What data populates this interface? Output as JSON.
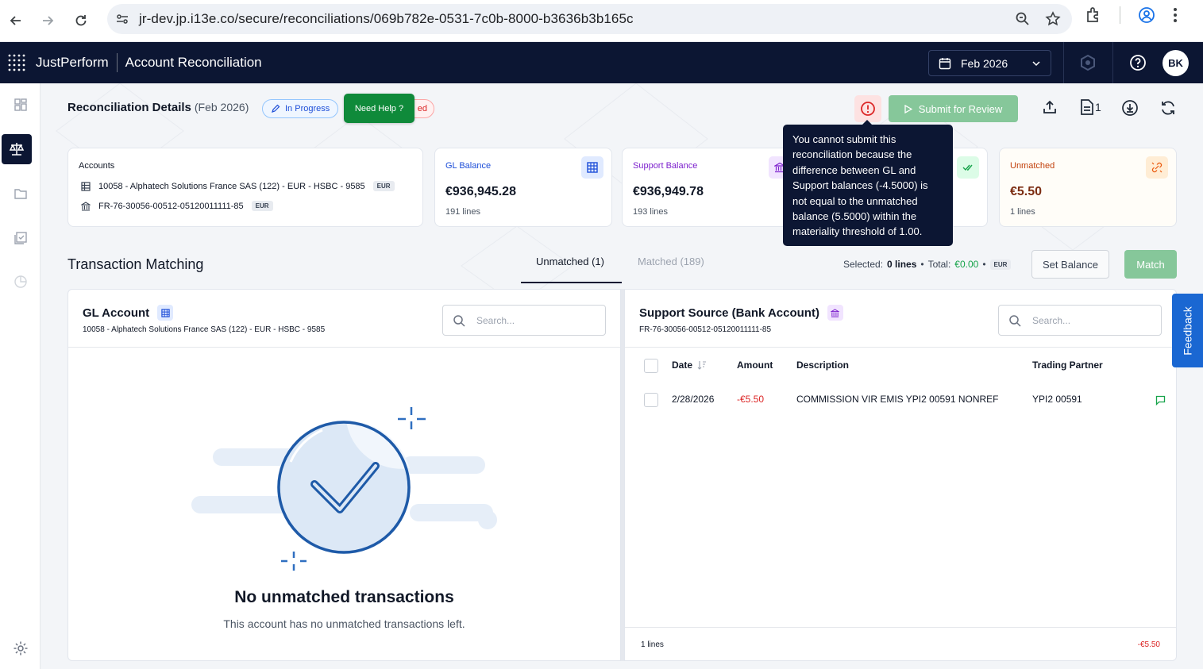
{
  "browser": {
    "url": "jr-dev.jp.i13e.co/secure/reconciliations/069b782e-0531-7c0b-8000-b3636b3b165c"
  },
  "header": {
    "brand": "JustPerform",
    "module": "Account Reconciliation",
    "period": "Feb 2026",
    "avatar": "BK"
  },
  "page": {
    "title": "Reconciliation Details",
    "period": "(Feb 2026)",
    "status": "In Progress",
    "hidden_pill": "ed",
    "help_label": "Need Help ?",
    "submit_label": "Submit for Review",
    "doc_count": "1",
    "tooltip": "You cannot submit this reconciliation because the difference between GL and Support balances (-4.5000) is not equal to the unmatched balance (5.5000) within the materiality threshold of 1.00."
  },
  "cards": {
    "accounts": {
      "label": "Accounts",
      "gl_account": "10058 - Alphatech Solutions France SAS (122) - EUR - HSBC - 9585",
      "gl_currency": "EUR",
      "bank_account": "FR-76-30056-00512-05120011111-85",
      "bank_currency": "EUR"
    },
    "gl": {
      "label": "GL Balance",
      "value": "€936,945.28",
      "lines": "191 lines"
    },
    "support": {
      "label": "Support Balance",
      "value": "€936,949.78",
      "lines": "193 lines"
    },
    "unmatched": {
      "label": "Unmatched",
      "value": "€5.50",
      "lines": "1 lines"
    }
  },
  "matching": {
    "title": "Transaction Matching",
    "tab_unmatched": "Unmatched (1)",
    "tab_matched": "Matched (189)",
    "selected_label": "Selected:",
    "selected_value": "0 lines",
    "total_label": "Total:",
    "total_value": "€0.00",
    "currency": "EUR",
    "set_balance": "Set Balance",
    "match": "Match"
  },
  "gl_panel": {
    "title": "GL Account",
    "subtitle": "10058 - Alphatech Solutions France SAS (122) - EUR - HSBC - 9585",
    "search_placeholder": "Search...",
    "empty_title": "No unmatched transactions",
    "empty_sub": "This account has no unmatched transactions left."
  },
  "support_panel": {
    "title": "Support Source (Bank Account)",
    "subtitle": "FR-76-30056-00512-05120011111-85",
    "search_placeholder": "Search...",
    "columns": {
      "date": "Date",
      "amount": "Amount",
      "description": "Description",
      "partner": "Trading Partner"
    },
    "rows": [
      {
        "date": "2/28/2026",
        "amount": "-€5.50",
        "description": "COMMISSION VIR EMIS YPI2 00591 NONREF",
        "partner": "YPI2 00591"
      }
    ],
    "footer_lines": "1 lines",
    "footer_total": "-€5.50"
  },
  "feedback": "Feedback",
  "colors": {
    "navy": "#0c1633",
    "green_button": "#86c79a",
    "help_green": "#0f8a3a",
    "negative": "#dc2626",
    "feedback_blue": "#1a67d2"
  }
}
